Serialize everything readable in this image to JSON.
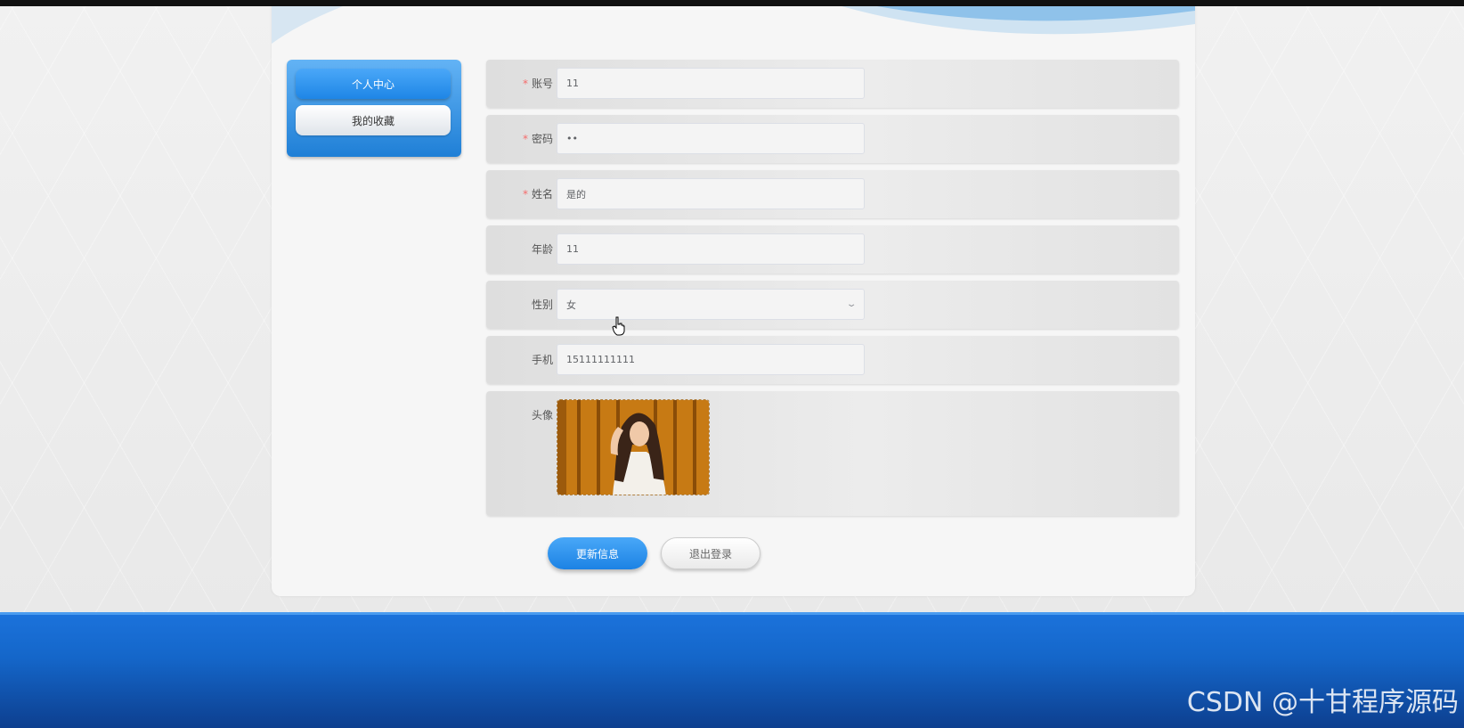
{
  "side_menu": {
    "items": [
      {
        "label": "个人中心",
        "active": true
      },
      {
        "label": "我的收藏",
        "active": false
      }
    ]
  },
  "form": {
    "account": {
      "label": "账号",
      "required": true,
      "value": "11"
    },
    "password": {
      "label": "密码",
      "required": true,
      "value": "••"
    },
    "name": {
      "label": "姓名",
      "required": true,
      "value": "是的"
    },
    "age": {
      "label": "年龄",
      "required": false,
      "value": "11"
    },
    "gender": {
      "label": "性别",
      "required": false,
      "value": "女"
    },
    "phone": {
      "label": "手机",
      "required": false,
      "value": "15111111111"
    },
    "avatar": {
      "label": "头像"
    }
  },
  "buttons": {
    "update": "更新信息",
    "logout": "退出登录"
  },
  "watermark": "CSDN @十甘程序源码",
  "colors": {
    "accent": "#1e86e6",
    "required": "#f56c6c",
    "footer": "#1466c9"
  },
  "icons": {
    "select_arrow": "chevron-down-icon",
    "cursor": "pointer-hand-icon"
  }
}
